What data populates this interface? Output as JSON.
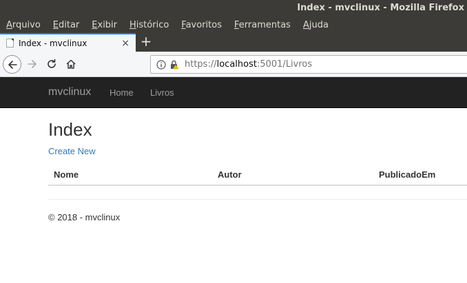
{
  "window": {
    "title": "Index - mvclinux - Mozilla Firefox"
  },
  "menubar": {
    "items": [
      "Arquivo",
      "Editar",
      "Exibir",
      "Histórico",
      "Favoritos",
      "Ferramentas",
      "Ajuda"
    ]
  },
  "tabs": [
    {
      "title": "Index - mvclinux",
      "close": "×",
      "active": true
    }
  ],
  "newtab": {
    "label": "+"
  },
  "urlbar": {
    "scheme": "https://",
    "host": "localhost",
    "rest": ":5001/Livros"
  },
  "site": {
    "brand": "mvclinux",
    "nav": [
      {
        "label": "Home"
      },
      {
        "label": "Livros"
      }
    ]
  },
  "main": {
    "title": "Index",
    "create_link": "Create New",
    "table": {
      "headers": [
        "Nome",
        "Autor",
        "PublicadoEm"
      ],
      "rows": []
    }
  },
  "footer": {
    "text": "© 2018 - mvclinux"
  },
  "colors": {
    "titlebar": "#3c3b37",
    "tab_accent": "#0a84ff",
    "site_nav": "#222222",
    "link": "#337ab7"
  }
}
